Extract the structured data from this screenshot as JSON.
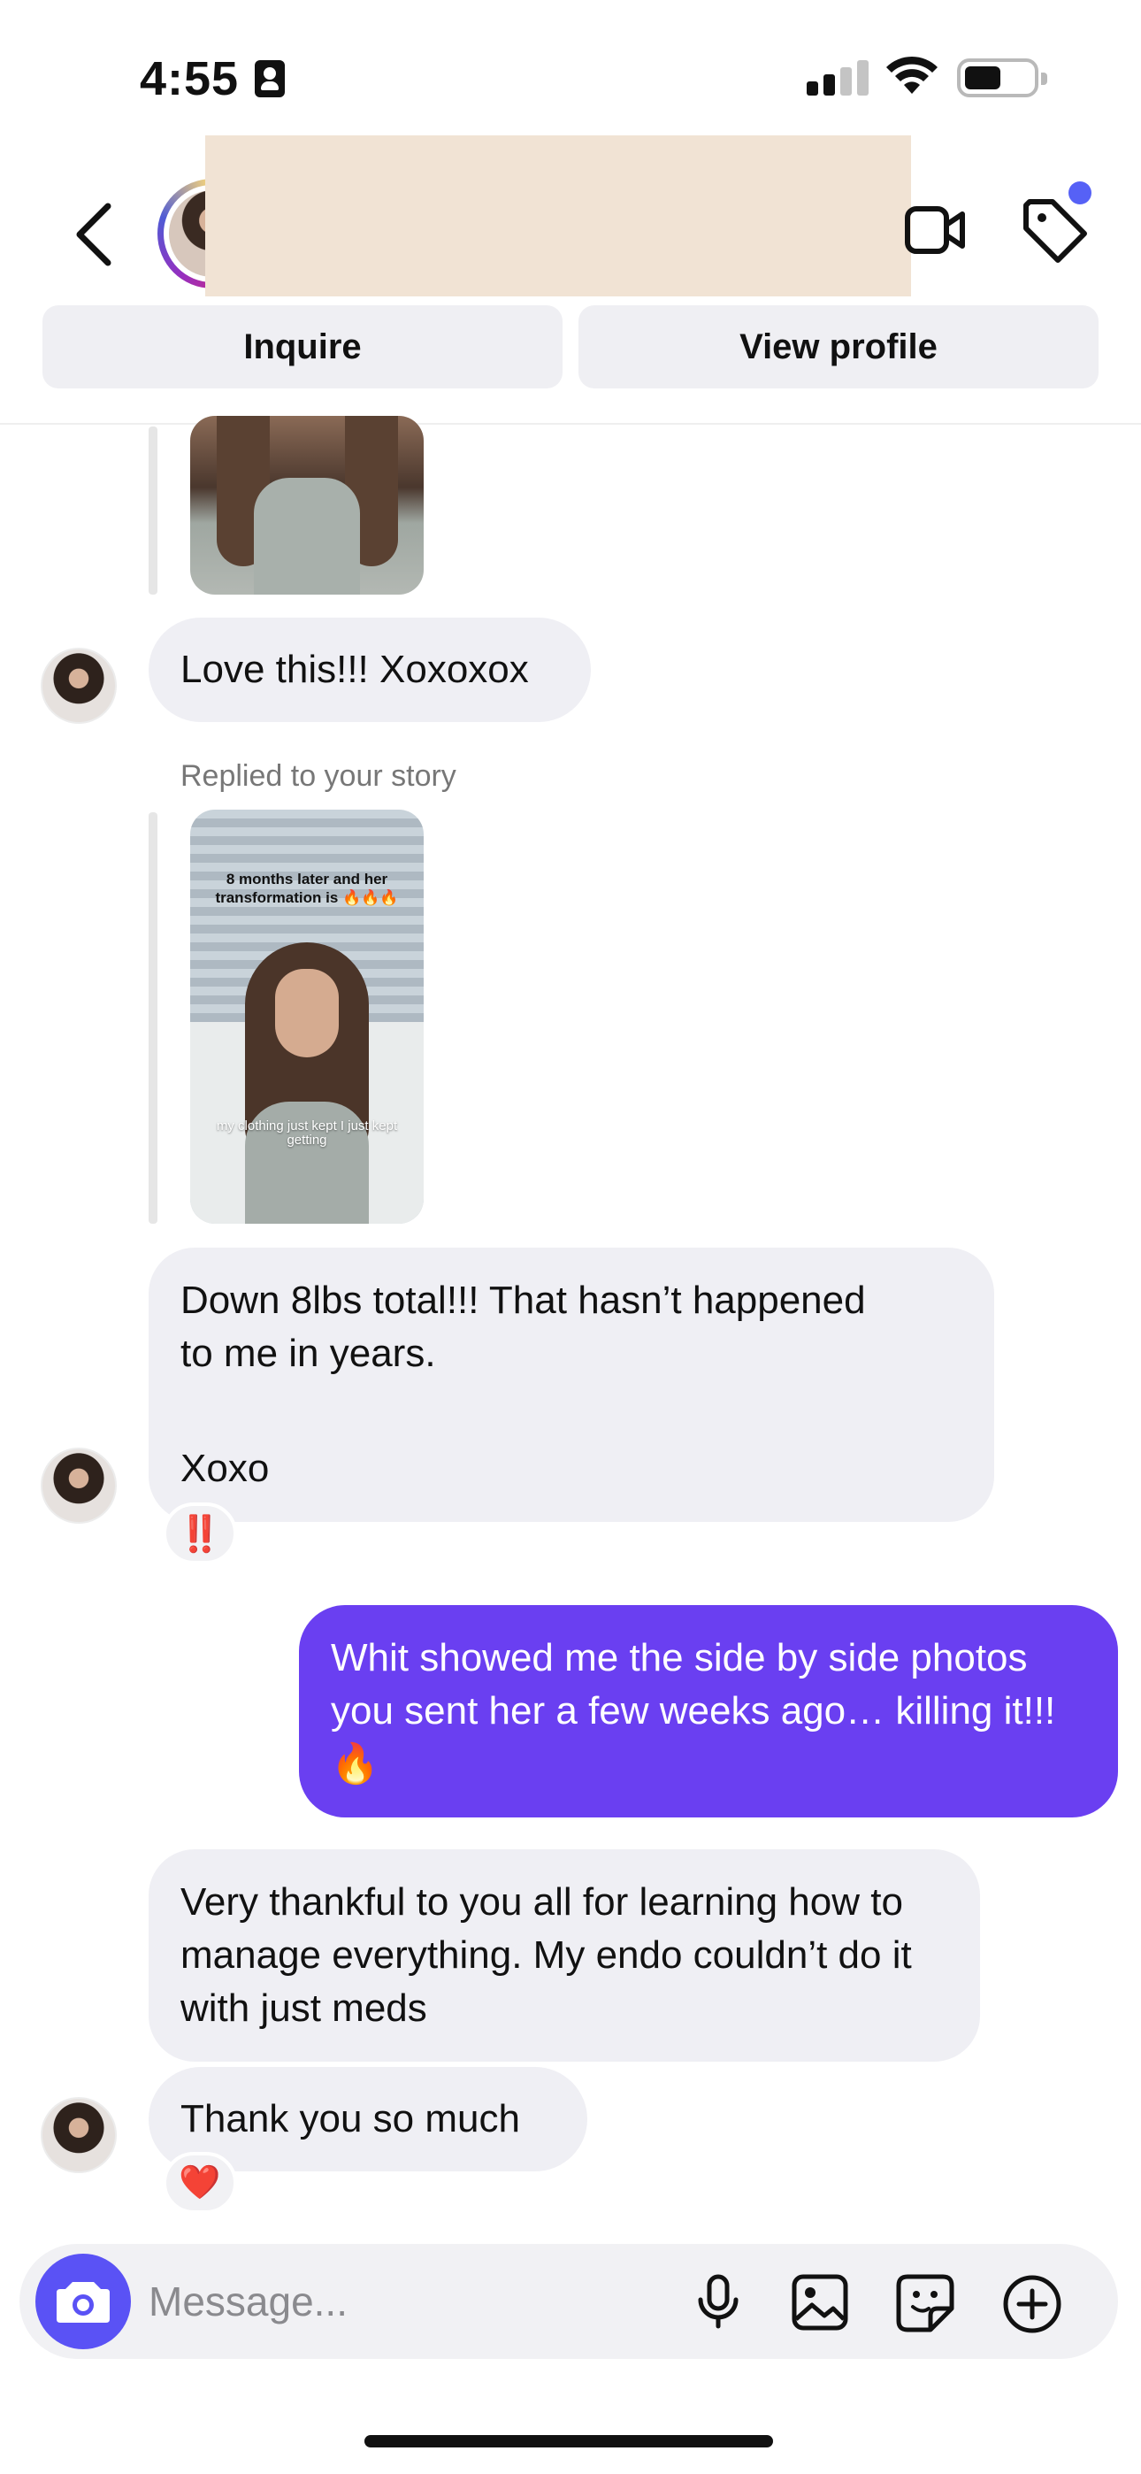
{
  "status_bar": {
    "time": "4:55",
    "icons": [
      "id-card-icon",
      "cellular-signal-icon",
      "wifi-icon",
      "battery-icon"
    ]
  },
  "header": {
    "back_icon": "chevron-left-icon",
    "video_icon": "video-camera-icon",
    "tag_icon": "tag-icon",
    "buttons": {
      "inquire": "Inquire",
      "view_profile": "View profile"
    }
  },
  "messages": {
    "msg1": "Love this!!! Xoxoxox",
    "story_reply_label": "Replied to your story",
    "story_caption_top": "8 months later and her transformation is 🔥🔥🔥",
    "story_caption_bottom": "my clothing just kept I just kept getting",
    "msg2_line1": "Down 8lbs total!!! That hasn’t happened",
    "msg2_line2": "to me in years.",
    "msg2_line3": "Xoxo",
    "msg2_reaction": "‼️",
    "msg3": "Whit showed me the side by side photos you sent her a few weeks ago… killing it!!!🔥",
    "msg4": "Very thankful to you all for learning how to manage everything. My endo couldn’t do it with just meds",
    "msg5": "Thank you so much",
    "msg5_reaction": "❤️"
  },
  "composer": {
    "placeholder": "Message...",
    "icons": [
      "camera-icon",
      "microphone-icon",
      "gallery-icon",
      "sticker-icon",
      "add-circle-icon"
    ]
  },
  "colors": {
    "outgoing_bubble": "#6a3ff1",
    "incoming_bubble": "#efeff4",
    "camera_button": "#5a52f5",
    "notification_dot": "#5661f6"
  }
}
